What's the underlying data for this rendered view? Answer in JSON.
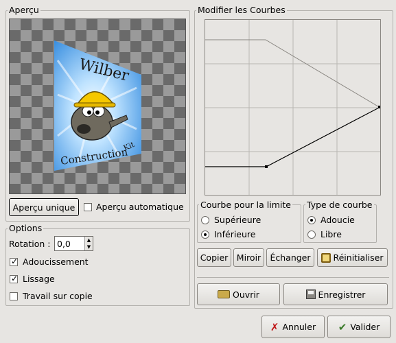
{
  "preview": {
    "title": "Aperçu",
    "button_label": "Aperçu unique",
    "auto_label": "Aperçu automatique",
    "auto_checked": false,
    "image_text_top": "Wilber",
    "image_text_bottom": "Construction",
    "image_text_kit": "Kit"
  },
  "options": {
    "title": "Options",
    "rotation_label": "Rotation :",
    "rotation_value": "0,0",
    "antialias_label": "Adoucissement",
    "antialias_checked": true,
    "smoothing_label": "Lissage",
    "smoothing_checked": true,
    "work_on_copy_label": "Travail sur copie",
    "work_on_copy_checked": false
  },
  "curves": {
    "title": "Modifier les Courbes",
    "boundary_title": "Courbe pour la limite",
    "upper_label": "Supérieure",
    "lower_label": "Inférieure",
    "boundary_selected": "Inférieure",
    "type_title": "Type de courbe",
    "smooth_label": "Adoucie",
    "free_label": "Libre",
    "type_selected": "Adoucie",
    "copy_label": "Copier",
    "mirror_label": "Miroir",
    "swap_label": "Échanger",
    "reset_label": "Réinitialiser",
    "open_label": "Ouvrir",
    "save_label": "Enregistrer"
  },
  "dialog": {
    "cancel_label": "Annuler",
    "ok_label": "Valider"
  },
  "colors": {
    "background": "#e7e5e2",
    "sky_blue": "#3a8fe0",
    "helmet_yellow": "#f5c800"
  }
}
